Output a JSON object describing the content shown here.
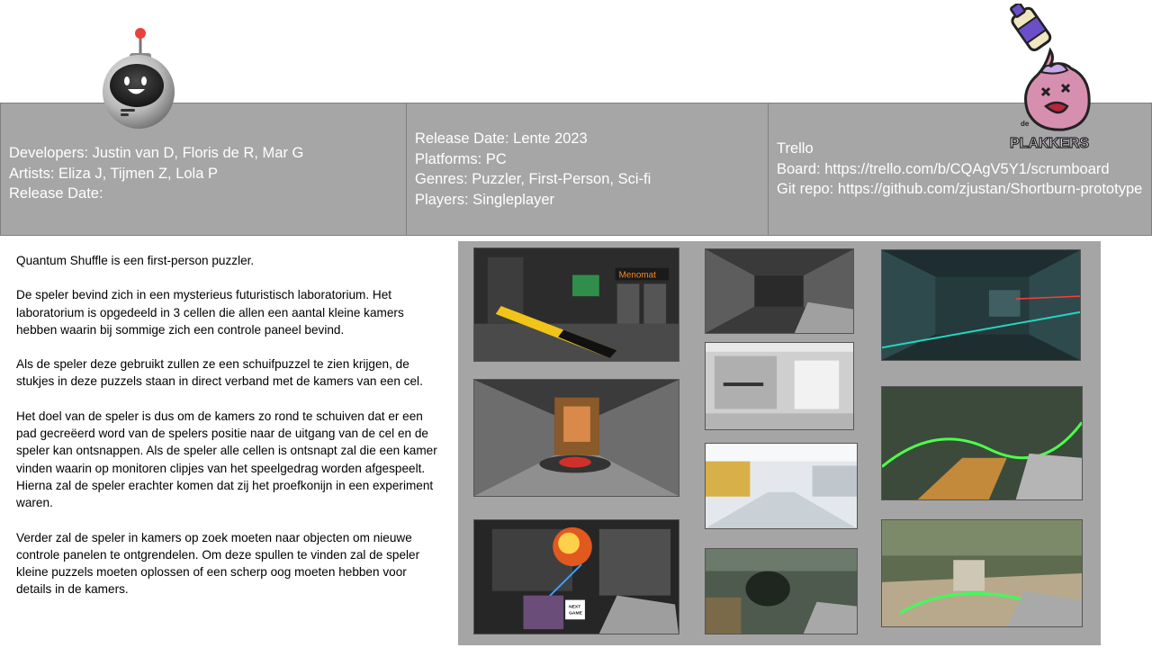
{
  "info": {
    "col1": [
      "Developers: Justin van D,  Floris de R, Mar G",
      "Artists: Eliza J, Tijmen Z, Lola P",
      "Release Date:"
    ],
    "col2": [
      "Release Date: Lente 2023",
      "Platforms: PC",
      "Genres: Puzzler, First-Person, Sci-fi",
      "Players: Singleplayer"
    ],
    "col3": [
      "Trello",
      "Board: https://trello.com/b/CQAgV5Y1/scrumboard",
      "Git repo: https://github.com/zjustan/Shortburn-prototype"
    ]
  },
  "description": {
    "paragraphs": [
      "Quantum Shuffle is een first-person puzzler.",
      "De speler bevind zich in een mysterieus futuristisch laboratorium. Het laboratorium is opgedeeld in 3 cellen die allen een aantal kleine kamers hebben waarin bij sommige zich een controle paneel bevind.",
      "Als de speler deze gebruikt zullen ze een schuifpuzzel te zien krijgen, de stukjes in deze puzzels staan in direct verband met de kamers van een cel.",
      "Het doel van de speler is dus om de kamers zo rond te schuiven dat er een pad gecreëerd word van de spelers positie naar de uitgang van de cel en de speler kan ontsnappen. Als de speler alle cellen is ontsnapt zal die een kamer vinden waarin op monitoren clipjes van het speelgedrag worden afgespeelt. Hierna zal de speler erachter komen dat zij het proefkonijn in een experiment waren.",
      "Verder zal de speler in kamers op zoek moeten naar objecten om nieuwe controle panelen te ontgrendelen. Om deze spullen te vinden zal de speler kleine puzzels moeten oplossen of een scherp oog moeten hebben voor details in de kamers."
    ]
  },
  "gallery": {
    "sign_text": "Menomat",
    "badge_lines": [
      "NEXT",
      "GAME"
    ]
  },
  "logo": {
    "text": "PLAKKERS",
    "prefix": "de"
  }
}
